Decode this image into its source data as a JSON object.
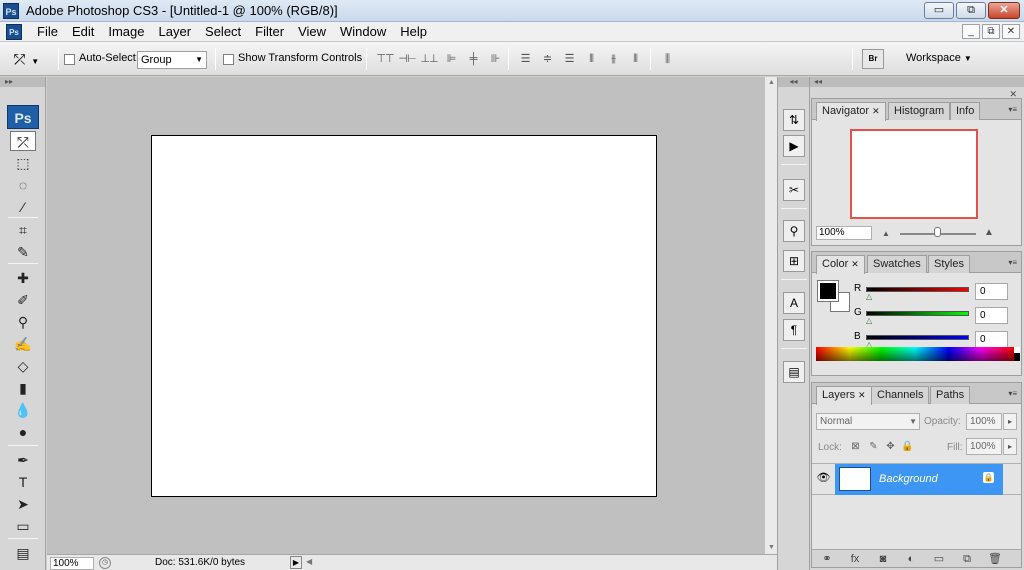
{
  "window": {
    "title": "Adobe Photoshop CS3 - [Untitled-1 @ 100% (RGB/8)]",
    "app_icon": "Ps",
    "buttons": {
      "minimize": "▭",
      "maximize": "⧉",
      "close": "✕"
    }
  },
  "menu": {
    "items": [
      "File",
      "Edit",
      "Image",
      "Layer",
      "Select",
      "Filter",
      "View",
      "Window",
      "Help"
    ],
    "doc_buttons": {
      "minimize": "_",
      "restore": "⧉",
      "close": "✕"
    }
  },
  "options": {
    "auto_select_label": "Auto-Select:",
    "auto_select_value": "Group",
    "show_transform_label": "Show Transform Controls",
    "workspace_label": "Workspace",
    "bridge_label": "Br"
  },
  "tools": {
    "logo": "Ps",
    "icons": [
      "move-tool-icon",
      "marquee-tool-icon",
      "lasso-tool-icon",
      "magic-wand-tool-icon",
      "crop-tool-icon",
      "slice-tool-icon",
      "healing-brush-tool-icon",
      "brush-tool-icon",
      "clone-stamp-tool-icon",
      "history-brush-tool-icon",
      "eraser-tool-icon",
      "gradient-tool-icon",
      "blur-tool-icon",
      "dodge-tool-icon",
      "pen-tool-icon",
      "type-tool-icon",
      "path-selection-tool-icon",
      "shape-tool-icon",
      "notes-tool-icon"
    ]
  },
  "status": {
    "zoom": "100%",
    "doc_info": "Doc: 531.6K/0 bytes"
  },
  "navigator": {
    "tabs": [
      "Navigator",
      "Histogram",
      "Info"
    ],
    "zoom": "100%",
    "preview_border_color": "#e0524a"
  },
  "color": {
    "tabs": [
      "Color",
      "Swatches",
      "Styles"
    ],
    "channels": [
      {
        "label": "R",
        "value": "0",
        "gradient": "linear-gradient(90deg,#000,#f00)"
      },
      {
        "label": "G",
        "value": "0",
        "gradient": "linear-gradient(90deg,#000,#0f0)"
      },
      {
        "label": "B",
        "value": "0",
        "gradient": "linear-gradient(90deg,#000,#00f)"
      }
    ],
    "foreground": "#000000",
    "background": "#ffffff"
  },
  "layers": {
    "tabs": [
      "Layers",
      "Channels",
      "Paths"
    ],
    "blend_mode": "Normal",
    "opacity_label": "Opacity:",
    "opacity_value": "100%",
    "lock_label": "Lock:",
    "fill_label": "Fill:",
    "fill_value": "100%",
    "layer_name": "Background",
    "selection_color": "#3d96f4"
  }
}
